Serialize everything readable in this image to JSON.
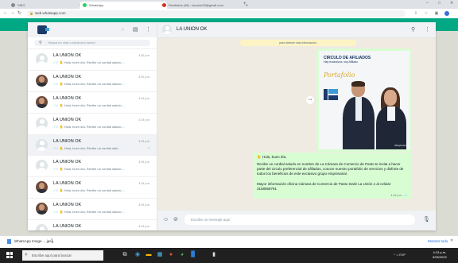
{
  "browser": {
    "tabs": [
      {
        "label": "SIEG"
      },
      {
        "label": "WhatsApp"
      },
      {
        "label": "Recibidos (48) - launion28@gmail.com"
      }
    ],
    "new_tab": "+",
    "url": "web.whatsapp.com",
    "window_controls": [
      "–",
      "□",
      "✕"
    ]
  },
  "sidebar": {
    "search_placeholder": "Busca un chat o inicia uno nuevo",
    "chats": [
      {
        "name": "LA UNION OK",
        "time": "4:20 p.m.",
        "preview": "Hola, buen día. Recibe un cordial saludo ...",
        "avatar": "placeholder",
        "selected": false
      },
      {
        "name": "LA UNION OK",
        "time": "4:20 p.m.",
        "preview": "Hola, buen día. Recibe un cordial saludo ...",
        "avatar": "photo",
        "selected": false
      },
      {
        "name": "LA UNION OK",
        "time": "4:19 p.m.",
        "preview": "Hola, buen día. Recibe un cordial saludo ...",
        "avatar": "photo",
        "selected": false
      },
      {
        "name": "LA UNION OK",
        "time": "4:19 p.m.",
        "preview": "Hola, buen día. Recibe un cordial saludo ...",
        "avatar": "placeholder",
        "selected": false
      },
      {
        "name": "LA UNION OK",
        "time": "4:19 p.m.",
        "preview": "Hola, buen día. Recibe un cordial salu...",
        "avatar": "placeholder",
        "selected": true
      },
      {
        "name": "LA UNION OK",
        "time": "4:19 p.m.",
        "preview": "Hola, buen día. Recibe un cordial saludo ...",
        "avatar": "placeholder",
        "selected": false
      },
      {
        "name": "LA UNION OK",
        "time": "4:19 p.m.",
        "preview": "Hola, buen día. Recibe un cordial saludo ...",
        "avatar": "photo",
        "selected": false
      },
      {
        "name": "LA UNION OK",
        "time": "4:19 p.m.",
        "preview": "Hola, buen día. Recibe un cordial saludo ...",
        "avatar": "photo",
        "selected": false
      },
      {
        "name": "LA UNION OK",
        "time": "4:19 p.m.",
        "preview": "Hola, buen día. Recibe un cordial saludo ...",
        "avatar": "placeholder",
        "selected": false
      }
    ]
  },
  "conversation": {
    "contact_name": "LA UNION OK",
    "system_message": "para obtener más información.",
    "flyer": {
      "title": "CIRCULO DE AFILIADOS",
      "subtitle": "Hay exclusivos, soy Afiliado",
      "script_word": "Portafolio",
      "mark": "#SoyUnion"
    },
    "message": {
      "greeting": "Hola, buen día.",
      "body": "Recibe un cordial saludo en nombre de La Cámara de Comercio de Pasto te invita a hacer parte del circulo preferencial de afiliados, conoce nuestro portafolio de servicios y disfrute de todos los beneficios de este exclusivo grupo empresarial.",
      "footer": "Mayor información oficina Cámara de Comercio de Pasto Sede La Unión o al celular 3158569791",
      "time": "4:19 p.m."
    },
    "composer_placeholder": "Escribe un mensaje aquí"
  },
  "downloads": {
    "file": "WhatsApp Image ....jpeg",
    "show_all": "Mostrar todo"
  },
  "taskbar": {
    "search_placeholder": "Escribe aquí para buscar",
    "tray": "^ ♫ ESP",
    "time": "4:23 p.m.",
    "date": "9/05/2022"
  },
  "colors": {
    "accent": "#00a884",
    "outgoing_bubble": "#d9fdd3",
    "chat_bg": "#efeae2",
    "ticks": "#53bdeb"
  }
}
